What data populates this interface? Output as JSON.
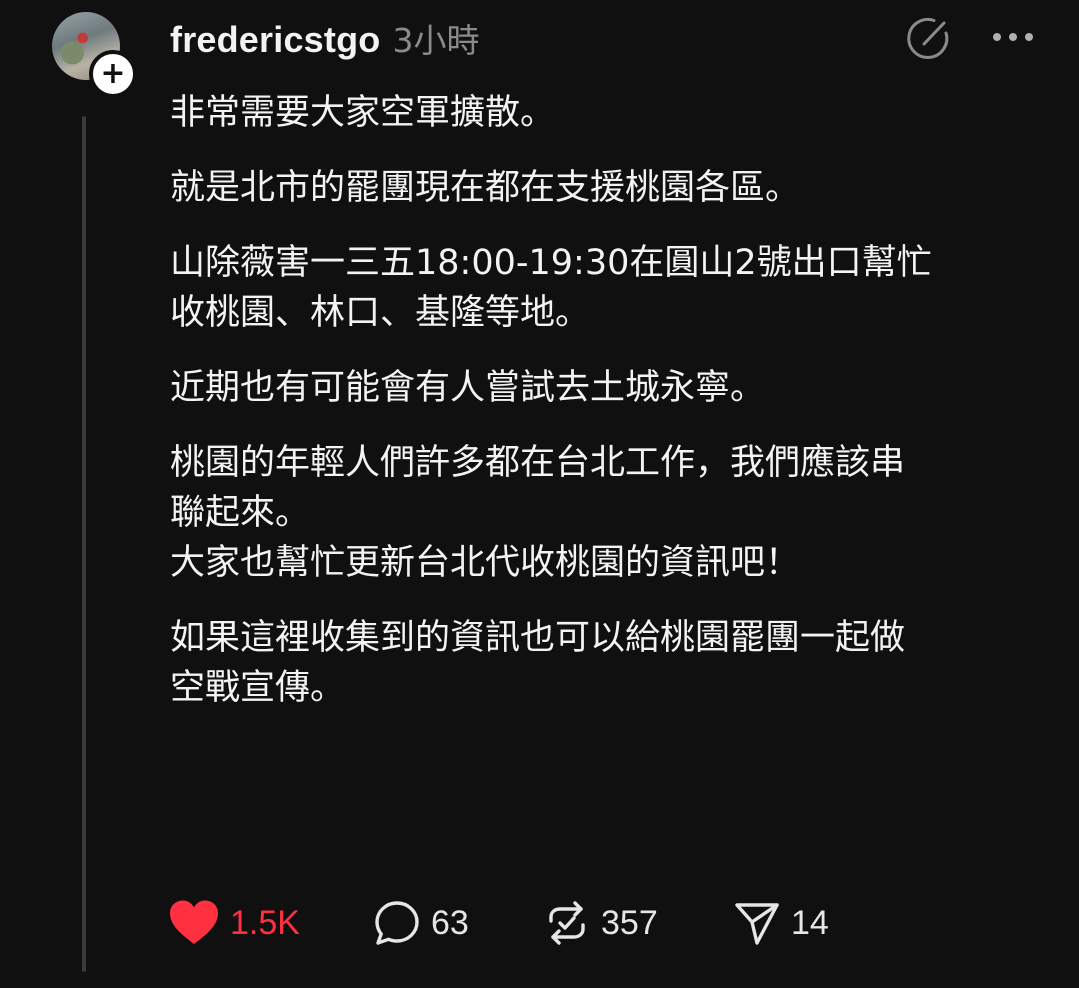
{
  "post": {
    "username": "fredericstgo",
    "timestamp": "3小時",
    "follow_symbol": "+",
    "paragraphs": [
      "非常需要大家空軍擴散。",
      "就是北市的罷團現在都在支援桃園各區。",
      "山除薇害一三五18:00-19:30在圓山2號出口幫忙\n收桃園、林口、基隆等地。",
      "近期也有可能會有人嘗試去土城永寧。",
      "桃園的年輕人們許多都在台北工作，我們應該串\n聯起來。\n大家也幫忙更新台北代收桃園的資訊吧！",
      "如果這裡收集到的資訊也可以給桃園罷團一起做\n空戰宣傳。"
    ]
  },
  "actions": {
    "like_count": "1.5K",
    "comment_count": "63",
    "repost_count": "357",
    "share_count": "14"
  },
  "icons": {
    "header": [
      "edit-icon",
      "more-icon"
    ],
    "actions": [
      "heart-icon",
      "comment-icon",
      "repost-icon",
      "share-icon"
    ]
  },
  "colors": {
    "background": "#101010",
    "like_red": "#ff3040",
    "muted_text": "#8a8a8a",
    "thread_line": "#3a3a3a"
  }
}
